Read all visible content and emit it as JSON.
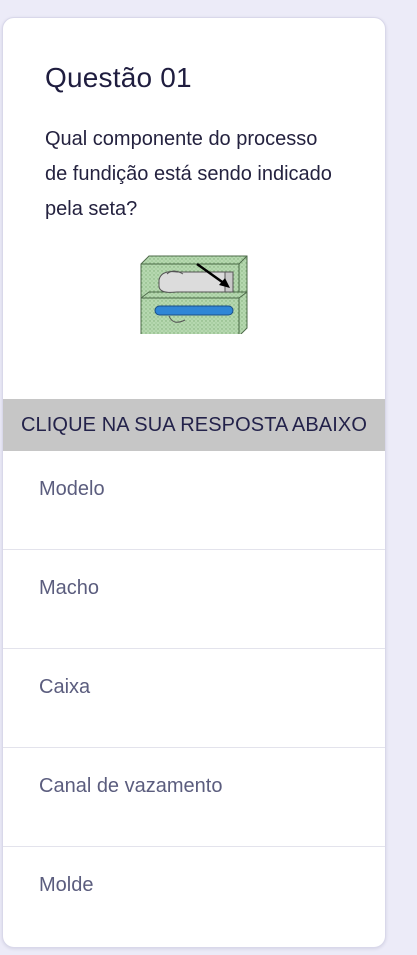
{
  "question": {
    "title": "Questão 01",
    "text": "Qual componente do processo de fundição está sendo indicado pela seta?",
    "figure_icon": "casting-mold-illustration"
  },
  "banner": {
    "text": "CLIQUE NA SUA RESPOSTA ABAIXO"
  },
  "answers": [
    {
      "label": "Modelo"
    },
    {
      "label": "Macho"
    },
    {
      "label": "Caixa"
    },
    {
      "label": "Canal de vazamento"
    },
    {
      "label": "Molde"
    }
  ],
  "colors": {
    "background": "#ecebf8",
    "card": "#ffffff",
    "banner": "#c6c6c6",
    "title_text": "#1f1d3f",
    "option_text": "#5b5d7e",
    "mold_green": "#a9d1a3",
    "core_blue": "#2f86d6"
  }
}
